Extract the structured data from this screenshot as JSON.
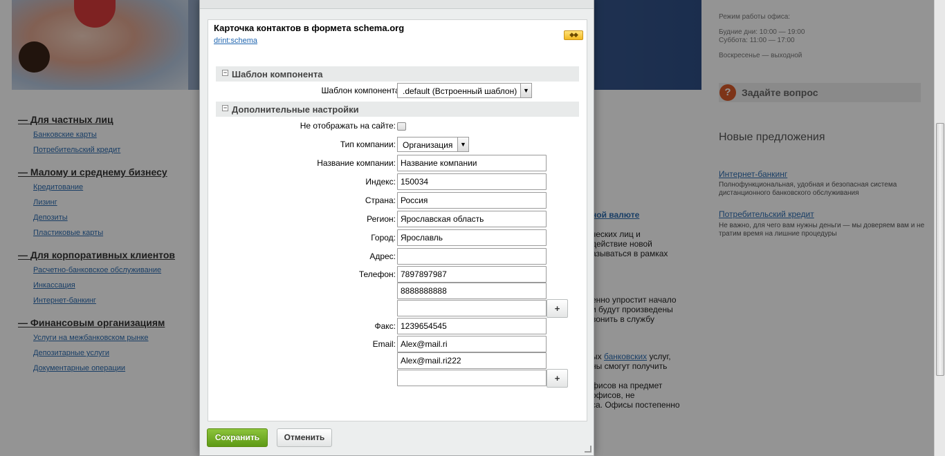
{
  "background": {
    "categories": [
      {
        "title": "Для частных лиц",
        "links": [
          "Банковские карты",
          "Потребительский кредит"
        ]
      },
      {
        "title": "Малому и среднему бизнесу",
        "links": [
          "Кредитование",
          "Лизинг",
          "Депозиты",
          "Пластиковые карты"
        ]
      },
      {
        "title": "Для корпоративных клиентов",
        "links": [
          "Расчетно-банковское обслуживание",
          "Инкассация",
          "Интернет-банкинг"
        ]
      },
      {
        "title": "Финансовым организациям",
        "links": [
          "Услуги на межбанковском рынке",
          "Депозитарные услуги",
          "Документарные операции"
        ]
      }
    ],
    "office": {
      "hours_title": "Режим работы офиса:",
      "weekdays": "Будние дни: 10:00 — 19:00",
      "saturday": "Суббота: 11:00 — 17:00",
      "sunday": "Воскресенье — выходной"
    },
    "ask_question": "Задайте вопрос",
    "new_offers": "Новые предложения",
    "offers": [
      {
        "title": "Интернет-банкинг",
        "desc": "Полнофункциональная, удобная и безопасная система дистанционного банковского обслуживания"
      },
      {
        "title": "Потребительский кредит",
        "desc": "Не важно, для чего вам нужны деньги — мы доверяем вам и не тратим время на лишние процедуры"
      }
    ],
    "mid_fragments": {
      "link1": "ной валюте",
      "l1": "ческих лиц и",
      "l2": "действие новой",
      "l3": "азываться в рамках",
      "l4": "енно упростит начало",
      "l5": "и будут произведены",
      "l6": "вонить в службу",
      "l7_pre": "ых ",
      "l7_link": "банковских",
      "l7_post": " услуг,",
      "l8": "ны смогут получить",
      "l9": "фисов на предмет",
      "l10": "офисов, не",
      "l11": "са. Офисы постепенно"
    }
  },
  "dialog": {
    "title": "Карточка контактов в формета schema.org",
    "link": "drint:schema",
    "section1": "Шаблон компонента",
    "section2": "Дополнительные настройки",
    "template_label": "Шаблон компонента:",
    "template_value": ".default (Встроенный шаблон)",
    "hide_label": "Не отображать на сайте:",
    "company_type_label": "Тип компании:",
    "company_type_value": "Организация",
    "company_name_label": "Название компании:",
    "company_name_value": "Название компании",
    "index_label": "Индекс:",
    "index_value": "150034",
    "country_label": "Страна:",
    "country_value": "Россия",
    "region_label": "Регион:",
    "region_value": "Ярославская область",
    "city_label": "Город:",
    "city_value": "Ярославль",
    "address_label": "Адрес:",
    "address_value": "",
    "phone_label": "Телефон:",
    "phones": [
      "7897897987",
      "8888888888",
      ""
    ],
    "fax_label": "Факс:",
    "fax_value": "1239654545",
    "email_label": "Email:",
    "emails": [
      "Alex@mail.ri",
      "Alex@mail.ri222",
      ""
    ],
    "plus": "+",
    "save": "Сохранить",
    "cancel": "Отменить",
    "icon": "puzzle-icon"
  }
}
